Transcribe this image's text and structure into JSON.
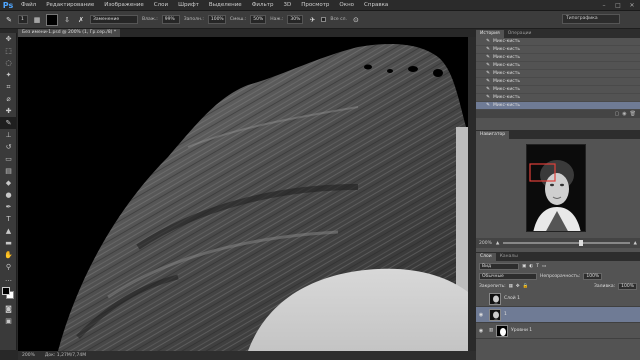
{
  "app": {
    "logo": "Ps"
  },
  "menu": [
    "Файл",
    "Редактирование",
    "Изображение",
    "Слои",
    "Шрифт",
    "Выделение",
    "Фильтр",
    "3D",
    "Просмотр",
    "Окно",
    "Справка"
  ],
  "options": {
    "brush_size": "1",
    "mode_value": "Заменение",
    "opacity_label": "Влаж.:",
    "opacity_value": "99%",
    "fill_label": "Заполн.:",
    "fill_value": "100%",
    "mix_label": "Смеш.:",
    "mix_value": "50%",
    "flow_label": "Наж.:",
    "flow_value": "30%",
    "all_layers_label": "Все сл.",
    "workspace": "Типографика"
  },
  "document": {
    "tab_title": "Без имени-1.psd @ 200% (1, Гр.сер./8) *",
    "zoom": "200%",
    "doc_info": "Док: 1,27М/7,74М"
  },
  "history_panel": {
    "tabs": [
      "История",
      "Операции"
    ],
    "items": [
      "Микс-кисть",
      "Микс-кисть",
      "Микс-кисть",
      "Микс-кисть",
      "Микс-кисть",
      "Микс-кисть",
      "Микс-кисть",
      "Микс-кисть",
      "Микс-кисть"
    ],
    "selected_index": 8
  },
  "navigator_panel": {
    "tab": "Навигатор",
    "zoom": "200%"
  },
  "layers_panel": {
    "tabs": [
      "Слои",
      "Каналы"
    ],
    "filter": "Вид",
    "blend_mode": "Обычные",
    "opacity_label": "Непрозрачность:",
    "opacity_value": "100%",
    "lock_label": "Закрепить:",
    "fill_label": "Заливка:",
    "fill_value": "100%",
    "layers": [
      {
        "name": "Слой 1",
        "selected": false
      },
      {
        "name": "1",
        "selected": true
      },
      {
        "name": "Уровни 1",
        "selected": false
      }
    ]
  },
  "colors": {
    "accent_selection": "#6f7b95",
    "nav_viewbox": "#e0403a",
    "ps_logo": "#4fa6ff"
  }
}
